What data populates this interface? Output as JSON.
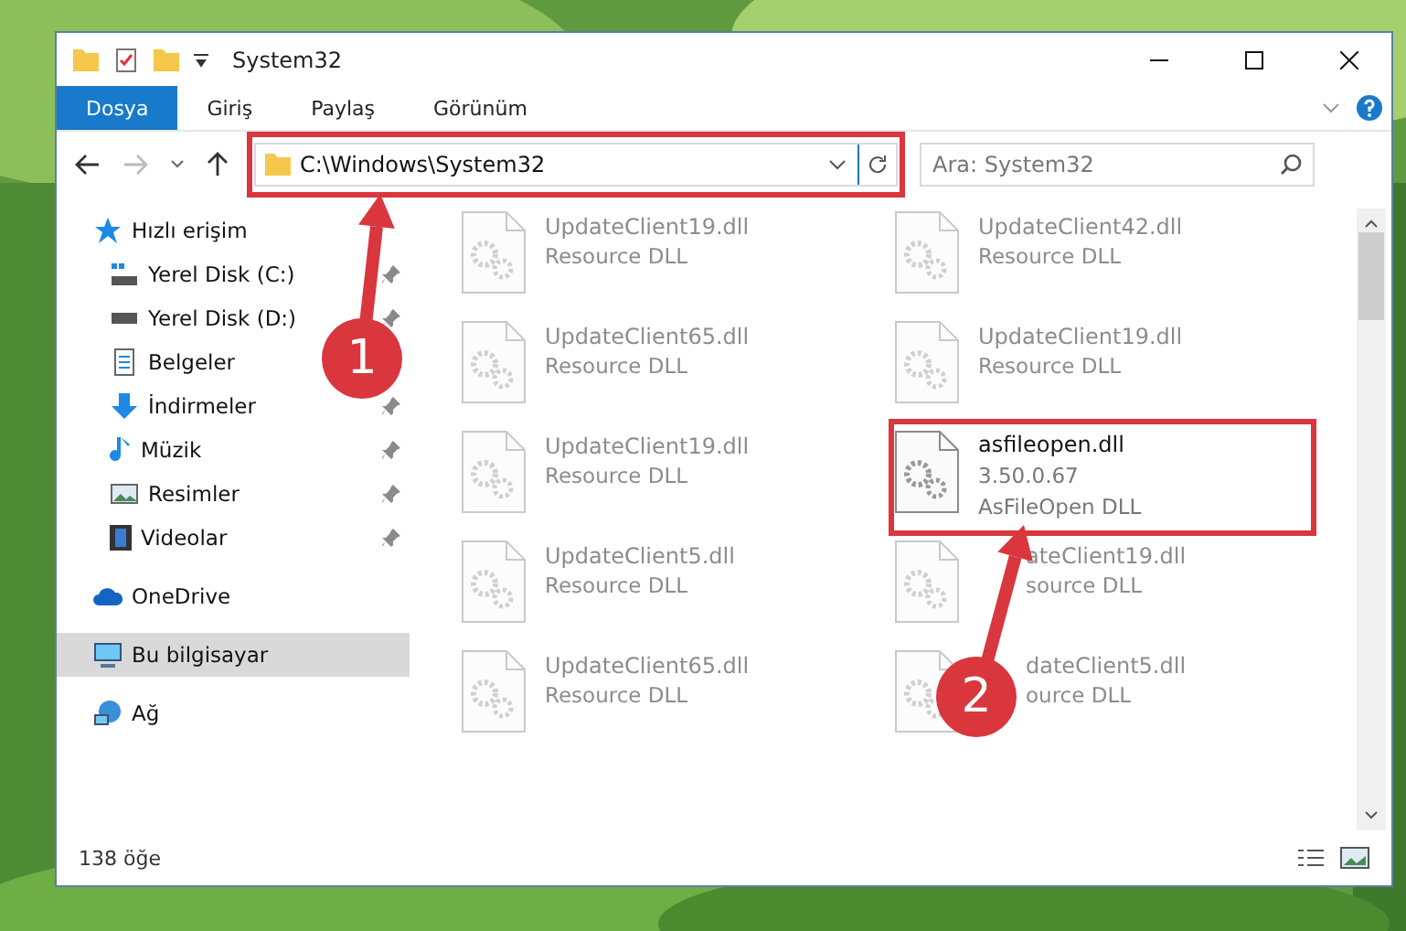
{
  "window": {
    "title": "System32"
  },
  "ribbon_tabs": [
    {
      "label": "Dosya",
      "selected": true
    },
    {
      "label": "Giriş",
      "selected": false
    },
    {
      "label": "Paylaş",
      "selected": false
    },
    {
      "label": "Görünüm",
      "selected": false
    }
  ],
  "address": {
    "path": "C:\\Windows\\System32"
  },
  "search": {
    "placeholder": "Ara: System32"
  },
  "sidebar": {
    "items": [
      {
        "label": "Hızlı erişim",
        "kind": "star",
        "pinned": false,
        "selected": false,
        "children": [
          {
            "label": "Yerel Disk (C:)",
            "kind": "drive-c",
            "pinned": true,
            "selected": false
          },
          {
            "label": "Yerel Disk (D:)",
            "kind": "drive",
            "pinned": true,
            "selected": false
          },
          {
            "label": "Belgeler",
            "kind": "docs",
            "selected": false
          },
          {
            "label": "İndirmeler",
            "kind": "download",
            "pinned": true,
            "selected": false
          },
          {
            "label": "Müzik",
            "kind": "music",
            "pinned": true,
            "selected": false
          },
          {
            "label": "Resimler",
            "kind": "pictures",
            "pinned": true,
            "selected": false
          },
          {
            "label": "Videolar",
            "kind": "videos",
            "pinned": true,
            "selected": false
          }
        ]
      },
      {
        "label": "OneDrive",
        "kind": "cloud",
        "pinned": false,
        "selected": false
      },
      {
        "label": "Bu bilgisayar",
        "kind": "pc",
        "pinned": false,
        "selected": true
      },
      {
        "label": "Ağ",
        "kind": "network",
        "pinned": false,
        "selected": false
      }
    ]
  },
  "files": [
    {
      "kind": "faded",
      "lines": [
        "UpdateClient19.dll",
        "Resource DLL"
      ]
    },
    {
      "kind": "faded",
      "lines": [
        "UpdateClient42.dll",
        "Resource DLL"
      ]
    },
    {
      "kind": "faded",
      "lines": [
        "UpdateClient65.dll",
        "Resource DLL"
      ]
    },
    {
      "kind": "faded",
      "lines": [
        "UpdateClient19.dll",
        "Resource DLL"
      ]
    },
    {
      "kind": "faded",
      "lines": [
        "UpdateClient19.dll",
        "Resource DLL"
      ]
    },
    {
      "kind": "file",
      "lines": [
        "asfileopen.dll",
        "3.50.0.67",
        "AsFileOpen DLL"
      ]
    },
    {
      "kind": "faded",
      "lines": [
        "UpdateClient5.dll",
        "Resource DLL"
      ]
    },
    {
      "kind": "covered",
      "lines": [
        "ateClient19.dll",
        "source DLL"
      ]
    },
    {
      "kind": "faded",
      "lines": [
        "UpdateClient65.dll",
        "Resource DLL"
      ]
    },
    {
      "kind": "covered",
      "lines": [
        "dateClient5.dll",
        "ource DLL"
      ]
    }
  ],
  "status_bar": {
    "count": "138 öğe"
  },
  "annotations": [
    {
      "number": "1"
    },
    {
      "number": "2"
    }
  ]
}
